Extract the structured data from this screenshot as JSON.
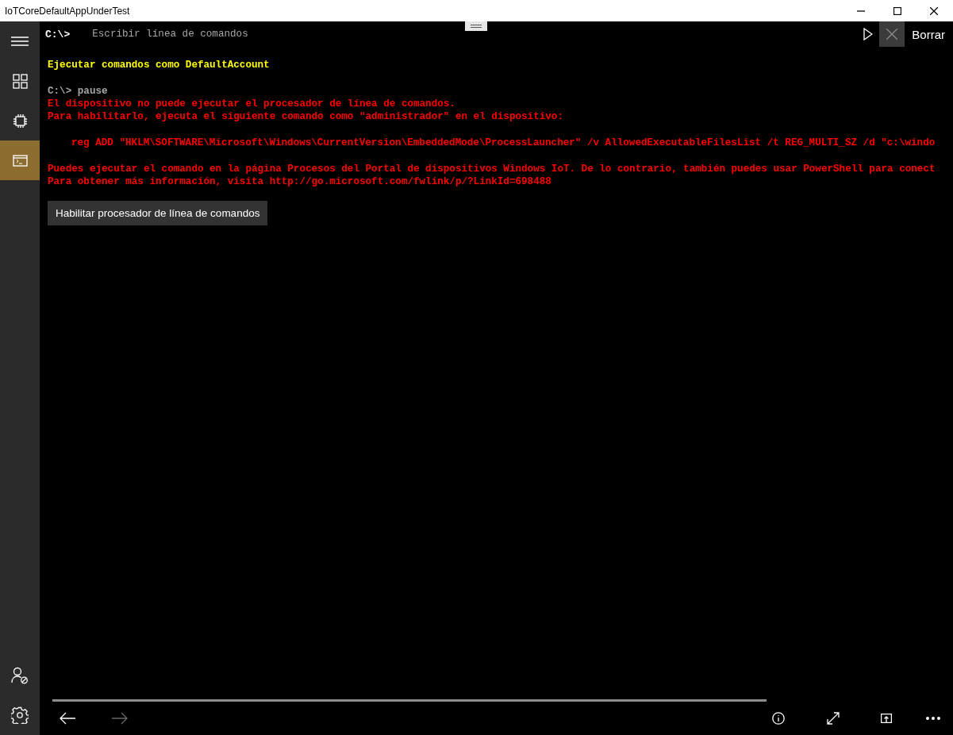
{
  "window": {
    "title": "IoTCoreDefaultAppUnderTest"
  },
  "sidebar": {
    "nav_items": [
      {
        "selected": false
      },
      {
        "selected": false
      },
      {
        "selected": true
      }
    ]
  },
  "command_bar": {
    "prompt": "C:\\>",
    "placeholder": "Escribir línea de comandos",
    "clear_label": "Borrar"
  },
  "output": {
    "blocks": [
      [
        {
          "kind": "info",
          "text": "Ejecutar comandos como DefaultAccount"
        }
      ],
      [
        {
          "kind": "echo",
          "text": "C:\\> pause"
        },
        {
          "kind": "error",
          "text": "El dispositivo no puede ejecutar el procesador de línea de comandos."
        },
        {
          "kind": "error",
          "text": "Para habilitarlo, ejecuta el siguiente comando como \"administrador\" en el dispositivo:"
        }
      ],
      [
        {
          "kind": "command",
          "text": "reg ADD \"HKLM\\SOFTWARE\\Microsoft\\Windows\\CurrentVersion\\EmbeddedMode\\ProcessLauncher\" /v AllowedExecutableFilesList /t REG_MULTI_SZ /d \"c:\\windo"
        }
      ],
      [
        {
          "kind": "error",
          "text": "Puedes ejecutar el comando en la página Procesos del Portal de dispositivos Windows IoT. De lo contrario, también puedes usar PowerShell para conect"
        },
        {
          "kind": "error",
          "text": "Para obtener más información, visita http://go.microsoft.com/fwlink/p/?LinkId=698488"
        }
      ]
    ]
  },
  "action_button": "Habilitar procesador de línea de comandos",
  "bottom_bar": {
    "back": {
      "disabled": false
    },
    "forward": {
      "disabled": true
    }
  }
}
